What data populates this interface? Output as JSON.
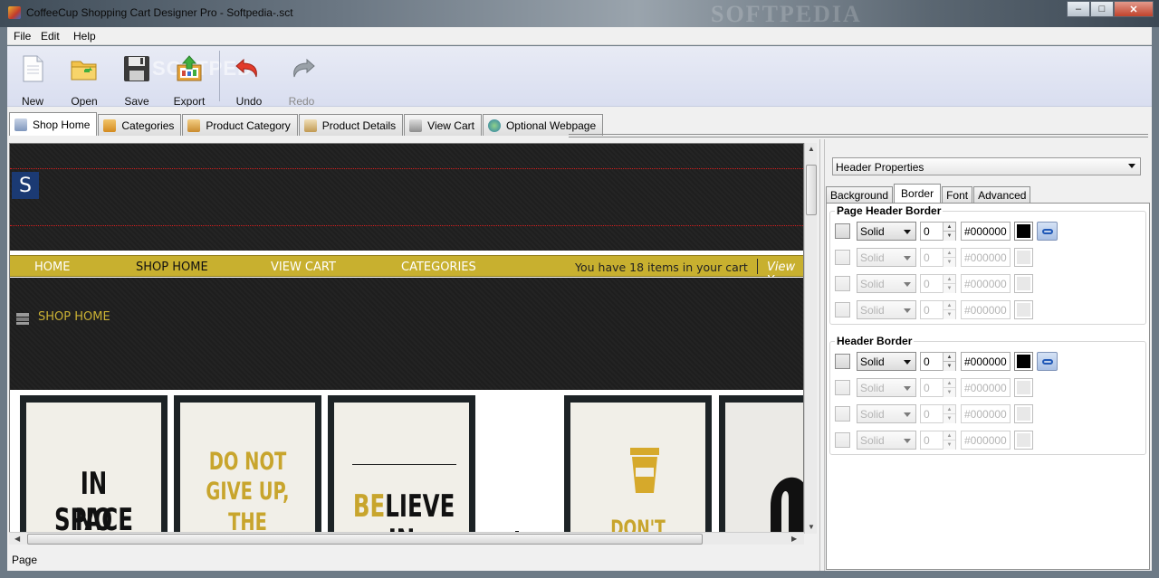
{
  "window": {
    "title": "CoffeeCup Shopping Cart Designer Pro - Softpedia-.sct",
    "watermark": "SOFTPEDIA",
    "minimize_symbol": "–",
    "maximize_symbol": "□",
    "close_symbol": "✕"
  },
  "menu": {
    "file": "File",
    "edit": "Edit",
    "help": "Help"
  },
  "toolbar": {
    "new": "New",
    "open": "Open",
    "save": "Save",
    "export": "Export",
    "undo": "Undo",
    "redo": "Redo",
    "watermark": "SOFTPED"
  },
  "tabs": [
    "Shop Home",
    "Categories",
    "Product Category",
    "Product Details",
    "View Cart",
    "Optional Webpage"
  ],
  "preview": {
    "logo_letter": "S",
    "nav": {
      "home": "HOME",
      "shop_home": "SHOP HOME",
      "view_cart": "VIEW CART",
      "categories": "CATEGORIES",
      "cart_count": "You have 18 items in your cart",
      "view_your": "View Y"
    },
    "breadcrumb": "SHOP HOME",
    "posters": {
      "p1_line1": "IN SPACE",
      "p1_line2": "NO ONE",
      "p2_line1": "DO NOT",
      "p2_line2": "GIVE UP,",
      "p2_line3": "THE BEGINNING",
      "p3_be": "BE",
      "p3_lieve": "LIEVE",
      "p3_in": "IN",
      "p4_text": "DON'T DISTURB"
    },
    "accent_gold": "#c8b02f",
    "header_bg": "#1f1f1f"
  },
  "status": {
    "text": "Page"
  },
  "panel": {
    "dropdown": "Header Properties",
    "tabs": {
      "background": "Background",
      "border": "Border",
      "font": "Font",
      "advanced": "Advanced"
    },
    "groups": {
      "page_header_border": {
        "title": "Page Header Border",
        "rows": [
          {
            "style": "Solid",
            "width": "0",
            "color": "#000000"
          },
          {
            "style": "Solid",
            "width": "0",
            "color": "#000000"
          },
          {
            "style": "Solid",
            "width": "0",
            "color": "#000000"
          },
          {
            "style": "Solid",
            "width": "0",
            "color": "#000000"
          }
        ]
      },
      "header_border": {
        "title": "Header Border",
        "rows": [
          {
            "style": "Solid",
            "width": "0",
            "color": "#000000"
          },
          {
            "style": "Solid",
            "width": "0",
            "color": "#000000"
          },
          {
            "style": "Solid",
            "width": "0",
            "color": "#000000"
          },
          {
            "style": "Solid",
            "width": "0",
            "color": "#000000"
          }
        ]
      }
    }
  }
}
